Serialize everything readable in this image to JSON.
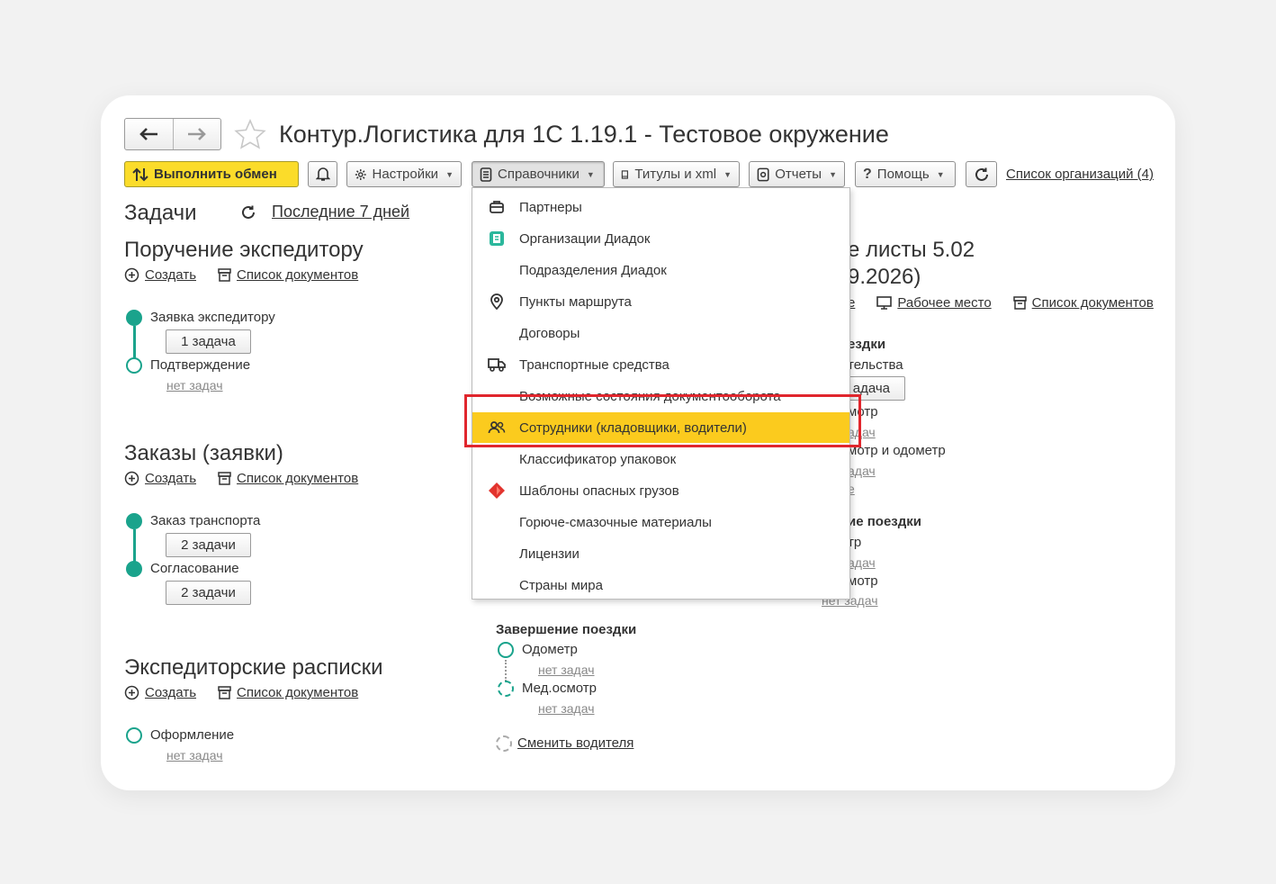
{
  "window": {
    "title": "Контур.Логистика для 1С 1.19.1 - Тестовое окружение"
  },
  "toolbar": {
    "exchange_label": "Выполнить обмен",
    "settings_label": "Настройки",
    "directories_label": "Справочники",
    "titles_label": "Титулы и xml",
    "reports_label": "Отчеты",
    "help_label": "Помощь",
    "org_list_label": "Список организаций (4)"
  },
  "tasks_header": {
    "title": "Задачи",
    "period_label": "Последние 7 дней"
  },
  "common": {
    "create_label": "Создать",
    "doc_list_label": "Список документов",
    "no_tasks": "нет задач"
  },
  "sections": {
    "forwarding": {
      "title": "Поручение экспедитору",
      "steps": [
        {
          "label": "Заявка экспедитору",
          "button": "1 задача"
        },
        {
          "label": "Подтверждение",
          "tasks": "нет задач"
        }
      ]
    },
    "orders": {
      "title": "Заказы (заявки)",
      "steps": [
        {
          "label": "Заказ транспорта",
          "button": "2 задачи"
        },
        {
          "label": "Согласование",
          "button": "2 задачи"
        }
      ]
    },
    "receipts": {
      "title": "Экспедиторские расписки",
      "steps": [
        {
          "label": "Оформление",
          "tasks": "нет задач"
        }
      ]
    },
    "waybills": {
      "title_line1": "е листы 5.02",
      "title_line2": "9.2026)",
      "partial_prefix": "е",
      "workplace_label": "Рабочее место",
      "doc_list_label": "Список документов",
      "before_trip_title": "ездки",
      "before_trip_line1": "тельства",
      "before_trip_button": "адача",
      "before_trip_line2": "мотр",
      "before_trip_line2_tasks": "адач",
      "before_trip_line3": "мотр и одометр",
      "before_trip_line3_tasks": "адач",
      "before_trip_line3_extra": "е",
      "after_trip_title": "ие поездки",
      "after_trip_line1": "тр",
      "after_trip_line1_tasks": "адач",
      "after_trip_line2": "мотр",
      "after_trip_line2_tasks": "нет задач",
      "end_trip_title": "Завершение поездки",
      "end_trip_steps": [
        {
          "label": "Одометр",
          "tasks": "нет задач"
        },
        {
          "label": "Мед.осмотр",
          "tasks": "нет задач"
        }
      ],
      "change_driver_label": "Сменить водителя"
    }
  },
  "menu": {
    "items": [
      {
        "label": "Партнеры",
        "icon": "partners-icon"
      },
      {
        "label": "Организации Диадок",
        "icon": "diadoc-org-icon"
      },
      {
        "label": "Подразделения Диадок",
        "icon": ""
      },
      {
        "label": "Пункты маршрута",
        "icon": "location-pin-icon"
      },
      {
        "label": "Договоры",
        "icon": ""
      },
      {
        "label": "Транспортные средства",
        "icon": "truck-icon"
      },
      {
        "label": "Возможные состояния документооборота",
        "icon": ""
      },
      {
        "label": "Сотрудники (кладовщики, водители)",
        "icon": "employees-icon",
        "active": true
      },
      {
        "label": "Классификатор упаковок",
        "icon": ""
      },
      {
        "label": "Шаблоны опасных грузов",
        "icon": "hazard-icon"
      },
      {
        "label": "Горюче-смазочные материалы",
        "icon": ""
      },
      {
        "label": "Лицензии",
        "icon": ""
      },
      {
        "label": "Страны мира",
        "icon": ""
      }
    ]
  },
  "colors": {
    "accent_yellow": "#fbdc2a",
    "menu_highlight": "#fbcb1e",
    "teal": "#1aa38c",
    "highlight_frame": "#e0262d"
  }
}
